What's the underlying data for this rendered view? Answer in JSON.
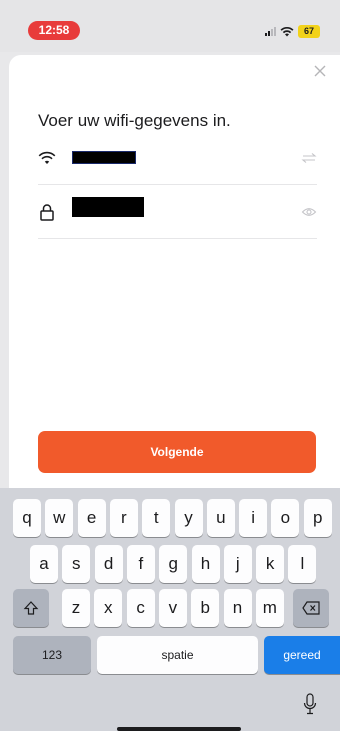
{
  "status_bar": {
    "time": "12:58",
    "battery": "67",
    "time_color": "#e83b3b"
  },
  "sheet": {
    "title": "Voer uw wifi-gegevens in.",
    "close_icon": "close-icon",
    "rows": [
      {
        "icon": "wifi-icon",
        "value_masked": true,
        "action_icon": "swap-icon"
      },
      {
        "icon": "lock-icon",
        "value_masked": true,
        "action_icon": "eye-icon"
      }
    ],
    "next_label": "Volgende",
    "accent": "#f15a2b"
  },
  "keyboard": {
    "row1": [
      "q",
      "w",
      "e",
      "r",
      "t",
      "y",
      "u",
      "i",
      "o",
      "p"
    ],
    "row2": [
      "a",
      "s",
      "d",
      "f",
      "g",
      "h",
      "j",
      "k",
      "l"
    ],
    "row3": [
      "z",
      "x",
      "c",
      "v",
      "b",
      "n",
      "m"
    ],
    "numbers_label": "123",
    "space_label": "spatie",
    "return_label": "gereed",
    "return_color": "#1a7ee8"
  }
}
